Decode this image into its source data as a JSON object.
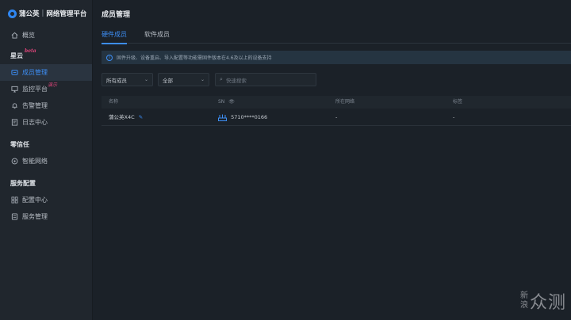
{
  "brand": {
    "name": "蒲公英",
    "separator": "|",
    "platform": "网络管理平台"
  },
  "sidebar": {
    "overview": "概览",
    "groups": [
      {
        "title": "星云",
        "badge": "beta",
        "items": [
          {
            "label": "成员管理",
            "icon": "member-icon",
            "active": true
          },
          {
            "label": "监控平台",
            "icon": "monitor-icon",
            "badge": "演示"
          },
          {
            "label": "告警管理",
            "icon": "bell-icon"
          },
          {
            "label": "日志中心",
            "icon": "log-icon"
          }
        ]
      },
      {
        "title": "零信任",
        "items": [
          {
            "label": "智能网络",
            "icon": "network-icon"
          }
        ]
      },
      {
        "title": "服务配置",
        "items": [
          {
            "label": "配置中心",
            "icon": "config-icon"
          },
          {
            "label": "服务管理",
            "icon": "service-icon"
          }
        ]
      }
    ]
  },
  "main": {
    "title": "成员管理",
    "tabs": [
      {
        "label": "硬件成员",
        "active": true
      },
      {
        "label": "软件成员"
      }
    ],
    "notice": "固件升级、设备重启、导入配置等功能需固件版本在4.6及以上的设备支持",
    "filters": {
      "member_select": "所有成员",
      "status_select": "全部",
      "search_placeholder": "快速搜索"
    },
    "table": {
      "headers": {
        "name": "名称",
        "sn": "SN",
        "network": "所在网络",
        "tag": "标签"
      },
      "rows": [
        {
          "name": "蒲公英X4C",
          "sn": "5710****0166",
          "network": "-",
          "tag": "-"
        }
      ]
    }
  },
  "watermark": {
    "line1": "新",
    "line2": "浪",
    "big": "众测"
  },
  "colors": {
    "accent": "#3d8ef5",
    "badge": "#e0457b",
    "background": "#1b2128",
    "sidebar": "#20262d"
  }
}
